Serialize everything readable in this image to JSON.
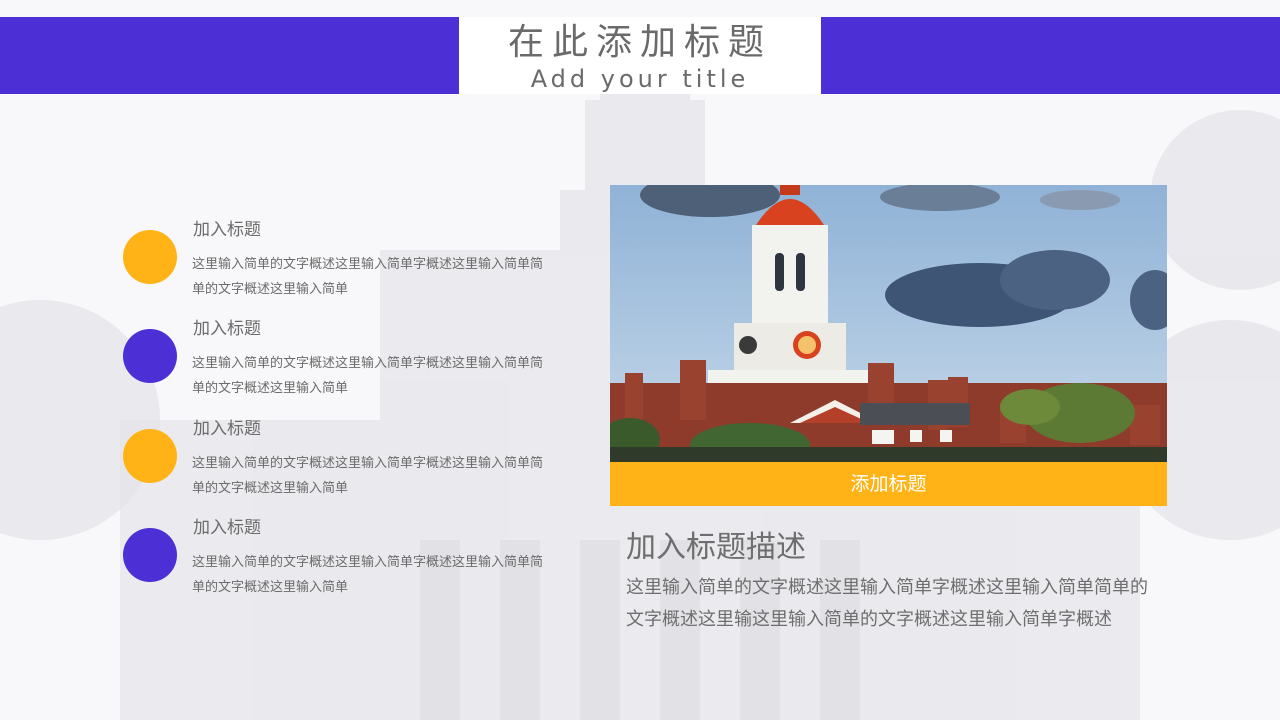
{
  "colors": {
    "purple": "#4d2fd6",
    "amber": "#ffb316",
    "white": "#ffffff"
  },
  "header": {
    "title_cn": "在此添加标题",
    "title_en": "Add your title"
  },
  "items": [
    {
      "title": "加入标题",
      "desc": "这里输入简单的文字概述这里输入简单字概述这里输入简单简单的文字概述这里输入简单",
      "color": "#ffb316"
    },
    {
      "title": "加入标题",
      "desc": "这里输入简单的文字概述这里输入简单字概述这里输入简单简单的文字概述这里输入简单",
      "color": "#4d2fd6"
    },
    {
      "title": "加入标题",
      "desc": "这里输入简单的文字概述这里输入简单字概述这里输入简单简单的文字概述这里输入简单",
      "color": "#ffb316"
    },
    {
      "title": "加入标题",
      "desc": "这里输入简单的文字概述这里输入简单字概述这里输入简单简单的文字概述这里输入简单",
      "color": "#4d2fd6"
    }
  ],
  "photo": {
    "caption": "添加标题",
    "icon": "clock-tower-photo"
  },
  "description": {
    "title": "加入标题描述",
    "body": "这里输入简单的文字概述这里输入简单字概述这里输入简单简单的文字概述这里输这里输入简单的文字概述这里输入简单字概述"
  }
}
